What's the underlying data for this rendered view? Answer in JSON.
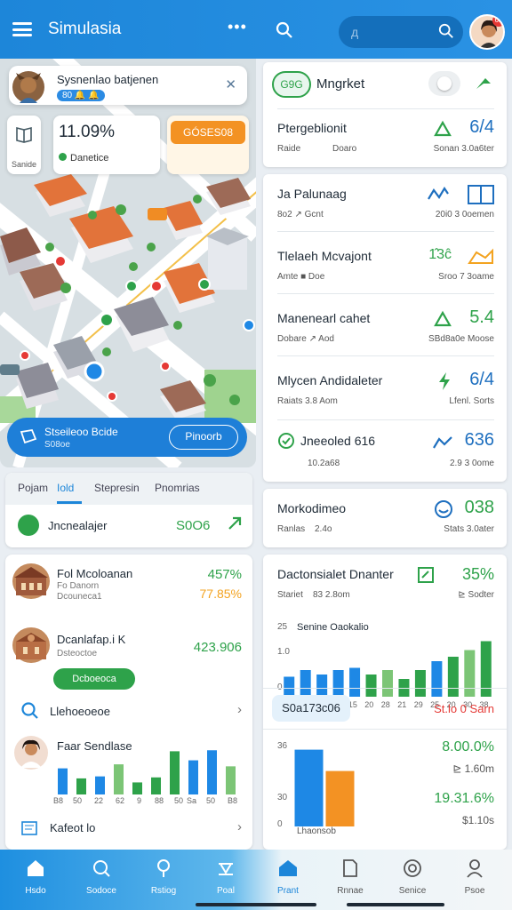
{
  "header": {
    "title": "Simulasia",
    "dots": "•••",
    "search_placeholder": "д",
    "avatar_badge": "61"
  },
  "map": {
    "profile_title": "Sysnenlao batjenen",
    "profile_chip": "80 🔔 🔔",
    "stat_value": "11.09%",
    "stat_sub": "Danetice",
    "side_label": "Sanide",
    "orange_button": "GÓSES08",
    "banner_title": "Stseileoo Bcide",
    "banner_sub": "S08oe",
    "banner_button": "Pinoorb"
  },
  "tabs": {
    "items": [
      "Pojam",
      "Iold",
      "Stepresin",
      "Pnomrias"
    ],
    "row_label": "Jncnealajer",
    "row_value": "S0O6"
  },
  "left_list": {
    "items": [
      {
        "title": "Fol Mcoloanan",
        "sub1": "Fo Danorn",
        "sub2": "Dcouneca1",
        "value": "457%",
        "value2": "77.85%"
      },
      {
        "title": "Dcanlafap.i K",
        "sub1": "Dsteoctoe",
        "value": "423.906",
        "button": "Dcboeoca"
      },
      {
        "title": "Llehoeoeoe"
      },
      {
        "title": "Faar Sendlase",
        "axis": [
          "B8",
          "50",
          "22",
          "62",
          "9",
          "88",
          "50",
          "Sa",
          "50",
          "B8"
        ]
      },
      {
        "title": "Kafeot lo"
      }
    ]
  },
  "right": {
    "top_pill": "G9G",
    "top_title": "Mngrket",
    "card1": {
      "title": "Ptergeblionit",
      "sub": "Raide",
      "sub2": "Doaro",
      "value": "6/4",
      "sub_right": "Sonan 3.0a6ter"
    },
    "rows": [
      {
        "title": "Ja Palunaag",
        "sub": "8o2 ↗ Gcnt",
        "value": "",
        "sub_right": "20i0 3 0oemen"
      },
      {
        "title": "Tlelaeh Mcvajont",
        "sub": "Amte ■ Doe",
        "value": "",
        "sub_right": "Sroo 7 3oame"
      },
      {
        "title": "Manenearl cahet",
        "sub": "Dobare ↗ Aod",
        "value": "5.4",
        "sub_right": "SBd8a0e Moose"
      },
      {
        "title": "Mlycen Andidaleter",
        "sub": "Raiats 3.8 Aom",
        "value": "6/4",
        "sub_right": "Lfenl. Sorts"
      },
      {
        "title": "Jneeoled 616",
        "sub": "10.2a68",
        "value": "636",
        "sub_right": "2.9 3 0ome"
      }
    ],
    "card3": {
      "title": "Morkodimeo",
      "sub": "Ranlas",
      "sub2": "2.4o",
      "value": "038",
      "sub_right": "Stats 3.0ater"
    },
    "card4": {
      "title": "Dactonsialet Dnanter",
      "value": "35%",
      "sub": "Stariet",
      "sub2": "83 2.8om",
      "sub_right": "⊵ Sodter",
      "chart_title": "Senine Oaokalio",
      "balance": "S0a173c06",
      "balance_right": "St.lo 0 Sarn",
      "v1": "8.00.0%",
      "v1b": "⊵ 1.60m",
      "v2": "19.31.6%",
      "v2b": "$1.10s",
      "axis_label": "Lhaonsob"
    }
  },
  "chart_data": [
    {
      "type": "bar",
      "title": "Senine Oaokalio",
      "categories": [
        "10",
        "20",
        "21",
        "3",
        "15",
        "20",
        "28",
        "21",
        "29",
        "25",
        "20",
        "30",
        "38"
      ],
      "values": [
        9,
        12,
        10,
        12,
        13,
        10,
        12,
        8,
        12,
        16,
        18,
        21,
        25
      ],
      "yticks": [
        "25",
        "1.0",
        "0"
      ],
      "colors": [
        "#1e88e5",
        "#1e88e5",
        "#1e88e5",
        "#1e88e5",
        "#1e88e5",
        "#2ea24a",
        "#7cc576",
        "#2ea24a",
        "#2ea24a",
        "#1e88e5",
        "#2ea24a",
        "#7cc576",
        "#2ea24a"
      ]
    },
    {
      "type": "bar",
      "title": "Faar Sendlase",
      "categories": [
        "B8",
        "50",
        "22",
        "62",
        "9",
        "88",
        "50",
        "Sa",
        "50",
        "B8"
      ],
      "values": [
        26,
        16,
        18,
        30,
        12,
        17,
        43,
        34,
        44,
        28
      ],
      "colors": [
        "#1e88e5",
        "#2ea24a",
        "#1e88e5",
        "#7cc576",
        "#2ea24a",
        "#2ea24a",
        "#2ea24a",
        "#1e88e5",
        "#1e88e5",
        "#7cc576"
      ]
    },
    {
      "type": "bar",
      "title": "",
      "categories": [
        "",
        ""
      ],
      "values": [
        36,
        26
      ],
      "yticks": [
        "36",
        "",
        "30",
        "0"
      ],
      "colors": [
        "#1e88e5",
        "#f39223"
      ]
    }
  ],
  "bottom_nav": [
    {
      "label": "Hsdo",
      "icon": "home-icon"
    },
    {
      "label": "Sodoce",
      "icon": "search-icon"
    },
    {
      "label": "Rstiog",
      "icon": "pin-icon"
    },
    {
      "label": "Poal",
      "icon": "ship-icon"
    },
    {
      "label": "Prant",
      "icon": "house-icon"
    },
    {
      "label": "Rnnae",
      "icon": "doc-icon"
    },
    {
      "label": "Senice",
      "icon": "target-icon"
    },
    {
      "label": "Psoe",
      "icon": "profile-icon"
    }
  ]
}
